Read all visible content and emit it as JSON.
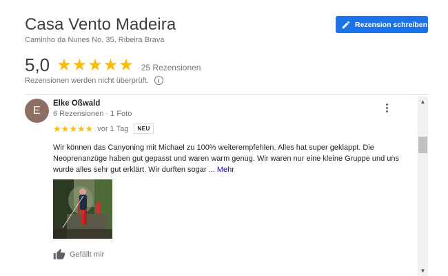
{
  "place": {
    "title": "Casa Vento Madeira",
    "address": "Caminho da Nunes No. 35, Ribeira Brava"
  },
  "write_review": {
    "label": "Rezension schreiben",
    "icon": "pencil-icon",
    "color": "#1a73e8"
  },
  "rating": {
    "value": "5,0",
    "stars": 5,
    "count_label": "25 Rezensionen",
    "note": "Rezensionen werden nicht überprüft.",
    "star_color": "#fbbc04"
  },
  "review": {
    "avatar_letter": "E",
    "avatar_color": "#8d6e63",
    "reviewer_name": "Elke Oßwald",
    "reviewer_meta": "6 Rezensionen · 1 Foto",
    "stars": 5,
    "age": "vor 1 Tag",
    "badge": "NEU",
    "text": "Wir können das Canyoning mit Michael zu 100% weiterempfehlen. Alles hat super geklappt. Die Neoprenanzüge haben gut gepasst und waren warm genug. Wir waren nur eine kleine Gruppe und uns wurde alles sehr gut erklärt. Wir durften sogar ...",
    "more_label": "Mehr",
    "like_label": "Gefällt mir"
  },
  "scrollbar": {
    "up_glyph": "▲",
    "down_glyph": "▼"
  }
}
